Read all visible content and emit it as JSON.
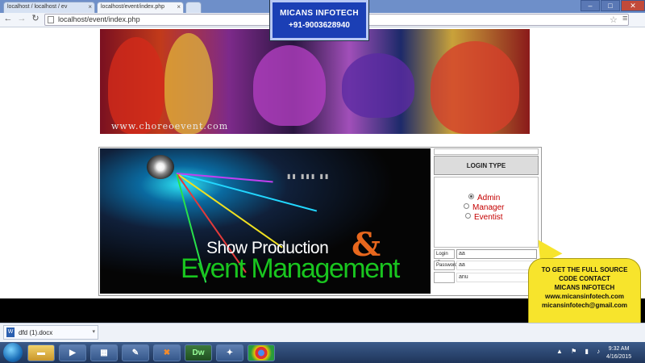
{
  "browser": {
    "tabs": [
      {
        "title": "localhost / localhost / ev"
      },
      {
        "title": "localhost/event/index.php"
      }
    ],
    "url": "localhost/event/index.php"
  },
  "advert": {
    "name": "MICANS INFOTECH",
    "phone": "+91-9003628940"
  },
  "banner": {
    "url_text": "www.choreoevent.com"
  },
  "hero": {
    "line1": "Show Production",
    "ampersand": "&",
    "line2": "Event Management"
  },
  "login": {
    "type_title": "LOGIN TYPE",
    "roles": [
      {
        "label": "Admin",
        "selected": true
      },
      {
        "label": "Manager",
        "selected": false
      },
      {
        "label": "Eventist",
        "selected": false
      }
    ],
    "login_id_label": "Login ID",
    "login_id_value": "aa",
    "password_label": "Password",
    "password_value": "aa",
    "extra_value": "anu"
  },
  "callout": {
    "line1": "TO GET THE FULL SOURCE",
    "line2": "CODE CONTACT",
    "line3": "MICANS INFOTECH",
    "line4": "www.micansinfotech.com",
    "line5": "micansinfotech@gmail.com"
  },
  "downloads": {
    "file": "dfd (1).docx"
  },
  "taskbar": {
    "time": "9:32 AM",
    "date": "4/16/2015",
    "apps": [
      "Dw",
      "✦"
    ]
  }
}
